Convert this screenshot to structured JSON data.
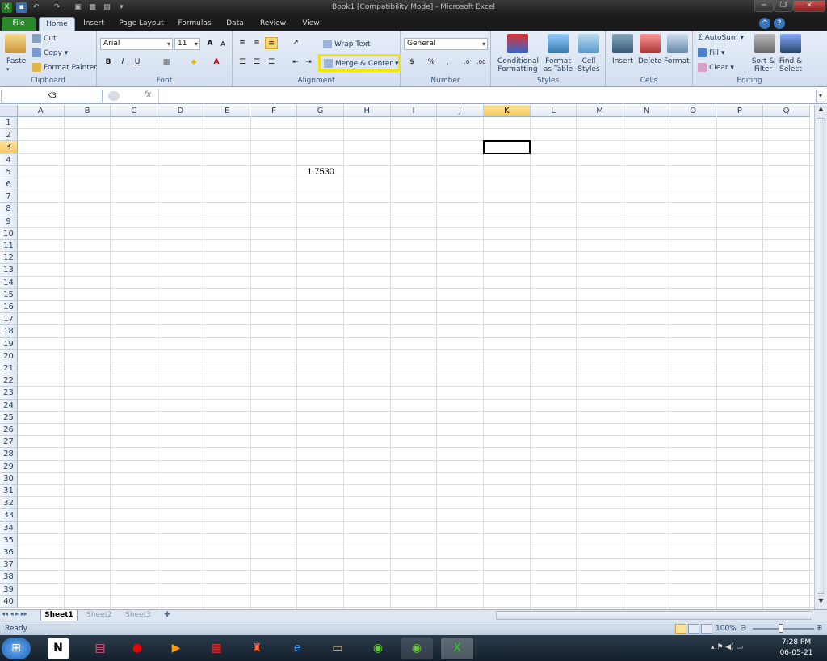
{
  "window": {
    "title": "Book1  [Compatibility Mode]  -  Microsoft Excel"
  },
  "ribbon_tabs": [
    "File",
    "Home",
    "Insert",
    "Page Layout",
    "Formulas",
    "Data",
    "Review",
    "View"
  ],
  "clipboard": {
    "paste": "Paste",
    "cut": "Cut",
    "copy": "Copy",
    "copy_arrow": "▾",
    "format_painter": "Format Painter",
    "label": "Clipboard"
  },
  "font": {
    "name": "Arial",
    "size": "11",
    "bold": "B",
    "italic": "I",
    "underline": "U",
    "label": "Font",
    "grow": "A",
    "shrink": "A"
  },
  "alignment": {
    "wrap_text": "Wrap Text",
    "merge_center": "Merge & Center",
    "label": "Alignment"
  },
  "number": {
    "format": "General",
    "currency": "$",
    "percent": "%",
    "comma": ",",
    "inc_dec": ".0",
    "dec_dec": ".00",
    "label": "Number"
  },
  "styles": {
    "conditional": "Conditional",
    "formatting": "Formatting",
    "format_as": "Format",
    "as_table": "as Table",
    "cell": "Cell",
    "cell_styles": "Styles",
    "label": "Styles"
  },
  "cells": {
    "insert": "Insert",
    "delete": "Delete",
    "format": "Format",
    "label": "Cells"
  },
  "editing": {
    "autosum": "AutoSum",
    "fill": "Fill",
    "clear": "Clear",
    "sort": "Sort &",
    "filter": "Filter",
    "find": "Find &",
    "select": "Select",
    "label": "Editing",
    "sigma": "Σ"
  },
  "formula_bar": {
    "name_box": "K3",
    "fx": "fx",
    "value": ""
  },
  "columns": [
    "A",
    "B",
    "C",
    "D",
    "E",
    "F",
    "G",
    "H",
    "I",
    "J",
    "K",
    "L",
    "M",
    "N",
    "O",
    "P",
    "Q"
  ],
  "selected_column": "K",
  "selected_row": 3,
  "rows": 40,
  "cells_data": [
    {
      "col": "G",
      "row": 5,
      "value": "1.7530"
    }
  ],
  "sheets": [
    "Sheet1",
    "Sheet2",
    "Sheet3"
  ],
  "active_sheet": "Sheet1",
  "status": {
    "ready": "Ready",
    "zoom": "100%"
  },
  "taskbar": {
    "time": "7:28 PM",
    "date": "06-05-21"
  },
  "highlight_color": "#f2e600",
  "accent_green": "#2a8a2a"
}
